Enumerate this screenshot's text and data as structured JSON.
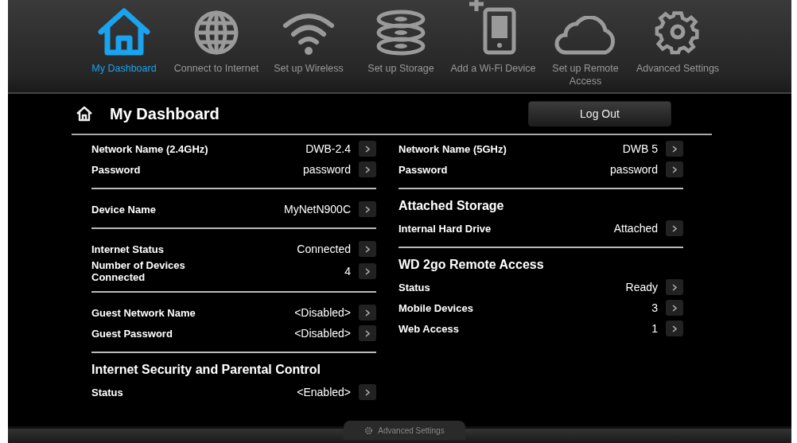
{
  "nav": [
    {
      "label": "My Dashboard",
      "kind": "house",
      "selected": true
    },
    {
      "label": "Connect to Internet",
      "kind": "globe",
      "selected": false
    },
    {
      "label": "Set up Wireless",
      "kind": "wifi",
      "selected": false
    },
    {
      "label": "Set up Storage",
      "kind": "disks",
      "selected": false
    },
    {
      "label": "Add a Wi-Fi Device",
      "kind": "tablet",
      "selected": false
    },
    {
      "label": "Set up Remote Access",
      "kind": "cloud",
      "selected": false
    },
    {
      "label": "Advanced Settings",
      "kind": "gear",
      "selected": false
    }
  ],
  "header": {
    "title": "My Dashboard",
    "logout": "Log Out"
  },
  "left_sections": [
    {
      "rows": [
        {
          "label": "Network Name (2.4GHz)",
          "value": "DWB-2.4"
        },
        {
          "label": "Password",
          "value": "password"
        }
      ]
    },
    {
      "rows": [
        {
          "label": "Device Name",
          "value": "MyNetN900C"
        }
      ]
    },
    {
      "rows": [
        {
          "label": "Internet Status",
          "value": "Connected"
        },
        {
          "label": "Number of Devices Connected",
          "value": "4"
        }
      ]
    },
    {
      "rows": [
        {
          "label": "Guest Network Name",
          "value": "<Disabled>"
        },
        {
          "label": "Guest Password",
          "value": "<Disabled>"
        }
      ]
    },
    {
      "title": "Internet Security and Parental Control",
      "rows": [
        {
          "label": "Status",
          "value": "<Enabled>"
        }
      ]
    }
  ],
  "right_sections": [
    {
      "rows": [
        {
          "label": "Network Name (5GHz)",
          "value": "DWB 5"
        },
        {
          "label": "Password",
          "value": "password"
        }
      ]
    },
    {
      "title": "Attached Storage",
      "rows": [
        {
          "label": "Internal Hard Drive",
          "value": "Attached"
        }
      ]
    },
    {
      "title": "WD 2go Remote Access",
      "rows": [
        {
          "label": "Status",
          "value": "Ready"
        },
        {
          "label": "Mobile Devices",
          "value": "3"
        },
        {
          "label": "Web Access",
          "value": "1"
        }
      ]
    }
  ],
  "footer_tab": "Advanced Settings"
}
